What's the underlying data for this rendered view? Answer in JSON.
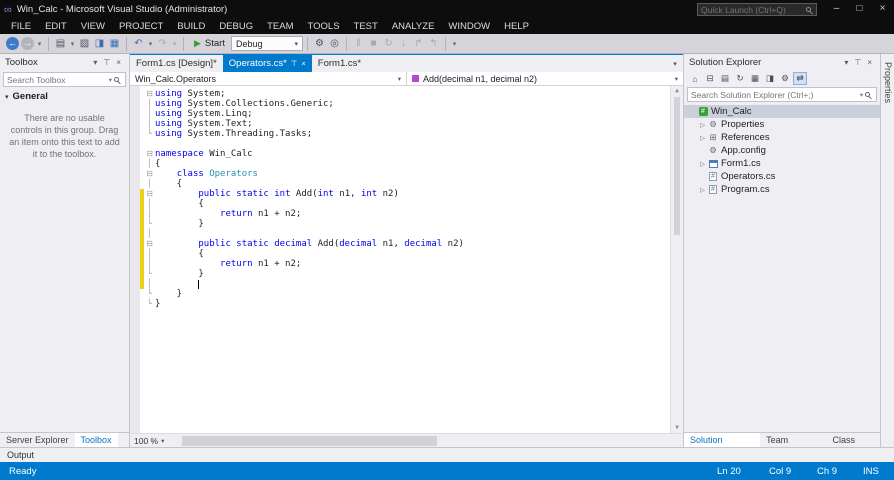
{
  "window": {
    "title": "Win_Calc - Microsoft Visual Studio (Administrator)",
    "quick_launch_placeholder": "Quick Launch (Ctrl+Q)",
    "controls": {
      "minimize": "–",
      "maximize": "□",
      "close": "×"
    }
  },
  "icons": {
    "logo": "∞",
    "window_menu": "▾",
    "pin": "⊤",
    "close": "×",
    "section_expander": "▾",
    "tab_dropdown": "▾",
    "scroll_up": "▲",
    "scroll_down": "▼"
  },
  "menu": {
    "items": [
      "FILE",
      "EDIT",
      "VIEW",
      "PROJECT",
      "BUILD",
      "DEBUG",
      "TEAM",
      "TOOLS",
      "TEST",
      "ANALYZE",
      "WINDOW",
      "HELP"
    ]
  },
  "toolbar": {
    "start_glyph": "▶",
    "start_label": "Start",
    "debug_config": "Debug",
    "items": [
      {
        "t": "icon",
        "name": "nav-back-icon",
        "g": "←",
        "s": "circle-blue"
      },
      {
        "t": "icon",
        "name": "nav-forward-icon",
        "g": "→",
        "s": "circle-gray"
      },
      {
        "t": "icon",
        "name": "nav-dropdown-icon",
        "g": "▾",
        "s": "dd"
      },
      {
        "t": "sep"
      },
      {
        "t": "icon",
        "name": "new-file-icon",
        "g": "▤",
        "s": ""
      },
      {
        "t": "icon",
        "name": "new-file-dropdown-icon",
        "g": "▾",
        "s": "dd"
      },
      {
        "t": "icon",
        "name": "open-file-icon",
        "g": "▨",
        "s": ""
      },
      {
        "t": "icon",
        "name": "save-icon",
        "g": "◨",
        "s": "blue"
      },
      {
        "t": "icon",
        "name": "save-all-icon",
        "g": "▦",
        "s": "blue"
      },
      {
        "t": "sep"
      },
      {
        "t": "icon",
        "name": "undo-icon",
        "g": "↶",
        "s": "blue"
      },
      {
        "t": "icon",
        "name": "undo-dropdown-icon",
        "g": "▾",
        "s": "dd"
      },
      {
        "t": "icon",
        "name": "redo-icon",
        "g": "↷",
        "s": "disabled"
      },
      {
        "t": "icon",
        "name": "redo-dropdown-icon",
        "g": "▾",
        "s": "dd disabled"
      },
      {
        "t": "sep"
      },
      {
        "t": "start"
      },
      {
        "t": "combo"
      },
      {
        "t": "sep"
      },
      {
        "t": "icon",
        "name": "solution-platforms-icon",
        "g": "⚙",
        "s": ""
      },
      {
        "t": "icon",
        "name": "find-in-files-icon",
        "g": "◎",
        "s": ""
      },
      {
        "t": "sep"
      },
      {
        "t": "icon",
        "name": "break-all-icon",
        "g": "‖",
        "s": "disabled"
      },
      {
        "t": "icon",
        "name": "stop-debugging-icon",
        "g": "■",
        "s": "disabled"
      },
      {
        "t": "icon",
        "name": "restart-icon",
        "g": "↻",
        "s": "disabled"
      },
      {
        "t": "icon",
        "name": "step-into-icon",
        "g": "↓",
        "s": "disabled"
      },
      {
        "t": "icon",
        "name": "step-over-icon",
        "g": "↱",
        "s": "disabled"
      },
      {
        "t": "icon",
        "name": "step-out-icon",
        "g": "↰",
        "s": "disabled"
      },
      {
        "t": "sep"
      },
      {
        "t": "icon",
        "name": "toolbar-options-icon",
        "g": "▾",
        "s": "dd"
      }
    ]
  },
  "toolbox": {
    "title": "Toolbox",
    "search_placeholder": "Search Toolbox",
    "section": "General",
    "empty_text": "There are no usable controls in this group. Drag an item onto this text to add it to the toolbox.",
    "bottom_tabs": [
      "Server Explorer",
      "Toolbox"
    ],
    "active_bottom_tab": 1
  },
  "editor": {
    "tabs": [
      {
        "label": "Form1.cs [Design]*",
        "active": false
      },
      {
        "label": "Operators.cs*",
        "active": true
      },
      {
        "label": "Form1.cs*",
        "active": false
      }
    ],
    "nav": {
      "type_dropdown": "Win_Calc.Operators",
      "member_dropdown": "Add(decimal n1, decimal n2)"
    },
    "zoom": "100 %",
    "changed_lines": {
      "from": 11,
      "to": 20
    },
    "cursor": {
      "line": 20,
      "col": 9
    },
    "outline": [
      "box",
      "line",
      "line",
      "line",
      "end",
      "",
      "box",
      "line",
      "box",
      "line",
      "box",
      "line",
      "line",
      "end",
      "line",
      "box",
      "line",
      "line",
      "end",
      "line",
      "end",
      "end"
    ],
    "lines": [
      [
        [
          "k",
          "using"
        ],
        [
          "p",
          " System;"
        ]
      ],
      [
        [
          "k",
          "using"
        ],
        [
          "p",
          " System.Collections.Generic;"
        ]
      ],
      [
        [
          "k",
          "using"
        ],
        [
          "p",
          " System.Linq;"
        ]
      ],
      [
        [
          "k",
          "using"
        ],
        [
          "p",
          " System.Text;"
        ]
      ],
      [
        [
          "k",
          "using"
        ],
        [
          "p",
          " System.Threading.Tasks;"
        ]
      ],
      [],
      [
        [
          "k",
          "namespace"
        ],
        [
          "p",
          " Win_Calc"
        ]
      ],
      [
        [
          "p",
          "{"
        ]
      ],
      [
        [
          "p",
          "    "
        ],
        [
          "k",
          "class"
        ],
        [
          "p",
          " "
        ],
        [
          "t",
          "Operators"
        ]
      ],
      [
        [
          "p",
          "    {"
        ]
      ],
      [
        [
          "p",
          "        "
        ],
        [
          "k",
          "public"
        ],
        [
          "p",
          " "
        ],
        [
          "k",
          "static"
        ],
        [
          "p",
          " "
        ],
        [
          "k",
          "int"
        ],
        [
          "p",
          " Add("
        ],
        [
          "k",
          "int"
        ],
        [
          "p",
          " n1, "
        ],
        [
          "k",
          "int"
        ],
        [
          "p",
          " n2)"
        ]
      ],
      [
        [
          "p",
          "        {"
        ]
      ],
      [
        [
          "p",
          "            "
        ],
        [
          "k",
          "return"
        ],
        [
          "p",
          " n1 + n2;"
        ]
      ],
      [
        [
          "p",
          "        }"
        ]
      ],
      [],
      [
        [
          "p",
          "        "
        ],
        [
          "k",
          "public"
        ],
        [
          "p",
          " "
        ],
        [
          "k",
          "static"
        ],
        [
          "p",
          " "
        ],
        [
          "k",
          "decimal"
        ],
        [
          "p",
          " Add("
        ],
        [
          "k",
          "decimal"
        ],
        [
          "p",
          " n1, "
        ],
        [
          "k",
          "decimal"
        ],
        [
          "p",
          " n2)"
        ]
      ],
      [
        [
          "p",
          "        {"
        ]
      ],
      [
        [
          "p",
          "            "
        ],
        [
          "k",
          "return"
        ],
        [
          "p",
          " n1 + n2;"
        ]
      ],
      [
        [
          "p",
          "        }"
        ]
      ],
      [
        [
          "p",
          "        "
        ],
        [
          "caret",
          ""
        ]
      ],
      [
        [
          "p",
          "    }"
        ]
      ],
      [
        [
          "p",
          "}"
        ]
      ]
    ]
  },
  "solution_explorer": {
    "title": "Solution Explorer",
    "search_placeholder": "Search Solution Explorer (Ctrl+;)",
    "toolbar_icons": [
      {
        "name": "home-icon",
        "g": "⌂"
      },
      {
        "name": "collapse-all-icon",
        "g": "⊟"
      },
      {
        "name": "pending-changes-filter-icon",
        "g": "▤"
      },
      {
        "name": "refresh-icon",
        "g": "↻"
      },
      {
        "name": "show-all-files-icon",
        "g": "▦"
      },
      {
        "name": "view-code-icon",
        "g": "◨"
      },
      {
        "name": "properties-window-icon",
        "g": "⚙"
      },
      {
        "name": "sync-with-active-document-icon",
        "g": "⇄",
        "pressed": true
      }
    ],
    "tree": [
      {
        "label": "Win_Calc",
        "icon": "csharp-project",
        "indent": 0,
        "selected": true,
        "arrow": false
      },
      {
        "label": "Properties",
        "icon": "properties",
        "indent": 1,
        "selected": false,
        "arrow": true
      },
      {
        "label": "References",
        "icon": "references",
        "indent": 1,
        "selected": false,
        "arrow": true
      },
      {
        "label": "App.config",
        "icon": "config",
        "indent": 1,
        "selected": false,
        "arrow": false
      },
      {
        "label": "Form1.cs",
        "icon": "form",
        "indent": 1,
        "selected": false,
        "arrow": true
      },
      {
        "label": "Operators.cs",
        "icon": "csharp-file",
        "indent": 1,
        "selected": false,
        "arrow": false
      },
      {
        "label": "Program.cs",
        "icon": "csharp-file",
        "indent": 1,
        "selected": false,
        "arrow": true
      }
    ],
    "bottom_tabs": [
      "Solution Explorer",
      "Team Explorer",
      "Class View"
    ],
    "active_bottom_tab": 0
  },
  "right_edge": {
    "vertical_tab": "Properties"
  },
  "output": {
    "label": "Output"
  },
  "status": {
    "ready": "Ready",
    "line": "Ln 20",
    "col": "Col 9",
    "ch": "Ch 9",
    "ins": "INS"
  }
}
